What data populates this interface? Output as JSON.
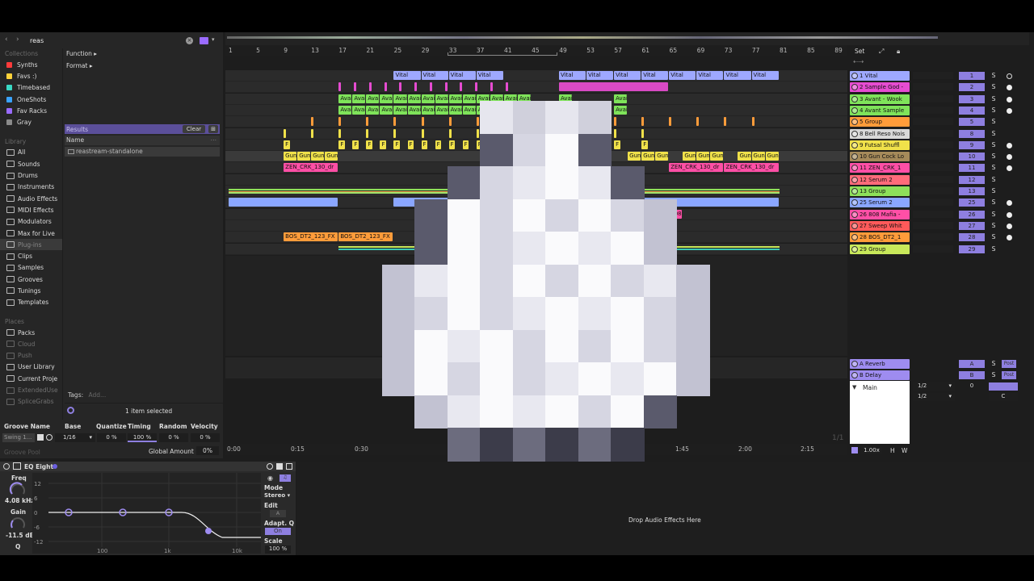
{
  "search": {
    "value": "reas"
  },
  "browser": {
    "collections_label": "Collections",
    "collections": [
      {
        "label": "Synths",
        "color": "#ff3b3b"
      },
      {
        "label": "Favs :)",
        "color": "#ffd23a"
      },
      {
        "label": "Timebased",
        "color": "#3ad9c4"
      },
      {
        "label": "OneShots",
        "color": "#3aa3ff"
      },
      {
        "label": "Fav Racks",
        "color": "#9a6bff"
      },
      {
        "label": "Gray",
        "color": "#8a8a8a"
      }
    ],
    "library_label": "Library",
    "library": [
      "All",
      "Sounds",
      "Drums",
      "Instruments",
      "Audio Effects",
      "MIDI Effects",
      "Modulators",
      "Max for Live",
      "Plug-ins",
      "Clips",
      "Samples",
      "Grooves",
      "Tunings",
      "Templates"
    ],
    "places_label": "Places",
    "places": [
      "Packs",
      "Cloud",
      "Push",
      "User Library",
      "Current Proje",
      "ExtendedUse",
      "SpliceGrabs"
    ],
    "filters": [
      "Function",
      "Format"
    ],
    "results_label": "Results",
    "clear_label": "Clear",
    "name_header": "Name",
    "result_item": "reastream-standalone",
    "tags_label": "Tags:",
    "tags_placeholder": "Add...",
    "selection_status": "1 item selected"
  },
  "groove": {
    "headers": [
      "Groove Name",
      "Base",
      "Quantize",
      "Timing",
      "Random",
      "Velocity"
    ],
    "row": {
      "name": "Swing 1...",
      "base": "1/16",
      "quantize": "0 %",
      "timing": "100 %",
      "random": "0 %",
      "velocity": "0 %"
    },
    "global_label": "Global Amount",
    "global_value": "0%",
    "pool_label": "Groove Pool"
  },
  "ruler": {
    "bars": [
      "1",
      "5",
      "9",
      "13",
      "17",
      "21",
      "25",
      "29",
      "33",
      "37",
      "41",
      "45",
      "49",
      "53",
      "57",
      "61",
      "65",
      "69",
      "73",
      "77",
      "81",
      "85",
      "89"
    ],
    "set_label": "Set"
  },
  "timeline": {
    "labels": [
      "0:00",
      "0:15",
      "0:30",
      "1:45",
      "2:00",
      "2:15"
    ],
    "zoom": "1/1"
  },
  "clips": {
    "vital": "Vital",
    "avant": "Avai",
    "gun": "Gun",
    "f": "F",
    "zen": "ZEN_CRK_130_dr",
    "bos": "BOS_DT2_123_FX",
    "b808": "808"
  },
  "tracks": [
    {
      "name": "1 Vital",
      "color": "#9ea8ff",
      "num": "1"
    },
    {
      "name": "2 Sample God -",
      "color": "#e64cd1",
      "num": "2"
    },
    {
      "name": "3 Avant - Wook",
      "color": "#7fe35a",
      "num": "3"
    },
    {
      "name": "4 Avant Sample",
      "color": "#7fe35a",
      "num": "4"
    },
    {
      "name": "5 Group",
      "color": "#ff9c3a",
      "num": "5"
    },
    {
      "name": "8 Bell Reso Nois",
      "color": "#d8d8d8",
      "num": "8"
    },
    {
      "name": "9 Futsal Shuffl",
      "color": "#f0e14a",
      "num": "9"
    },
    {
      "name": "10 Gun Cock Lo",
      "color": "#a58a5a",
      "num": "10"
    },
    {
      "name": "11 ZEN_CRK_1",
      "color": "#ff4fa6",
      "num": "11"
    },
    {
      "name": "12 Serum 2",
      "color": "#ff6b7a",
      "num": "12"
    },
    {
      "name": "13 Group",
      "color": "#8ee05a",
      "num": "13"
    },
    {
      "name": "25 Serum 2",
      "color": "#8aa6ff",
      "num": "25"
    },
    {
      "name": "26 808 Mafia -",
      "color": "#ff4fa6",
      "num": "26"
    },
    {
      "name": "27 Sweep Whit",
      "color": "#ff5a5a",
      "num": "27"
    },
    {
      "name": "28 BOS_DT2_1",
      "color": "#ff9c3a",
      "num": "28"
    },
    {
      "name": "29 Group",
      "color": "#c8e85a",
      "num": "29"
    }
  ],
  "returns": [
    {
      "name": "A Reverb",
      "color": "#9e8cf0",
      "letter": "A",
      "post": "Post"
    },
    {
      "name": "B Delay",
      "color": "#9e8cf0",
      "letter": "B",
      "post": "Post"
    }
  ],
  "main": {
    "label": "Main",
    "tempo1": "1/2",
    "tempo2": "1/2",
    "vol": "0",
    "pan": "C",
    "zoom_value": "1.00x",
    "h": "H",
    "w": "W",
    "s": "S"
  },
  "eq": {
    "title": "EQ Eight",
    "freq_label": "Freq",
    "freq_value": "4.08 kHz",
    "gain_label": "Gain",
    "gain_value": "-11.5 dB",
    "q_label": "Q",
    "db_ticks": [
      "12",
      "6",
      "0",
      "-6",
      "-12"
    ],
    "freq_ticks": [
      "100",
      "1k",
      "10k"
    ],
    "mode_label": "Mode",
    "mode_value": "Stereo",
    "edit_label": "Edit",
    "adapt_label": "Adapt. Q",
    "adapt_value": "On",
    "scale_label": "Scale",
    "scale_value": "100 %"
  },
  "drop_hint": "Drop Audio Effects Here"
}
